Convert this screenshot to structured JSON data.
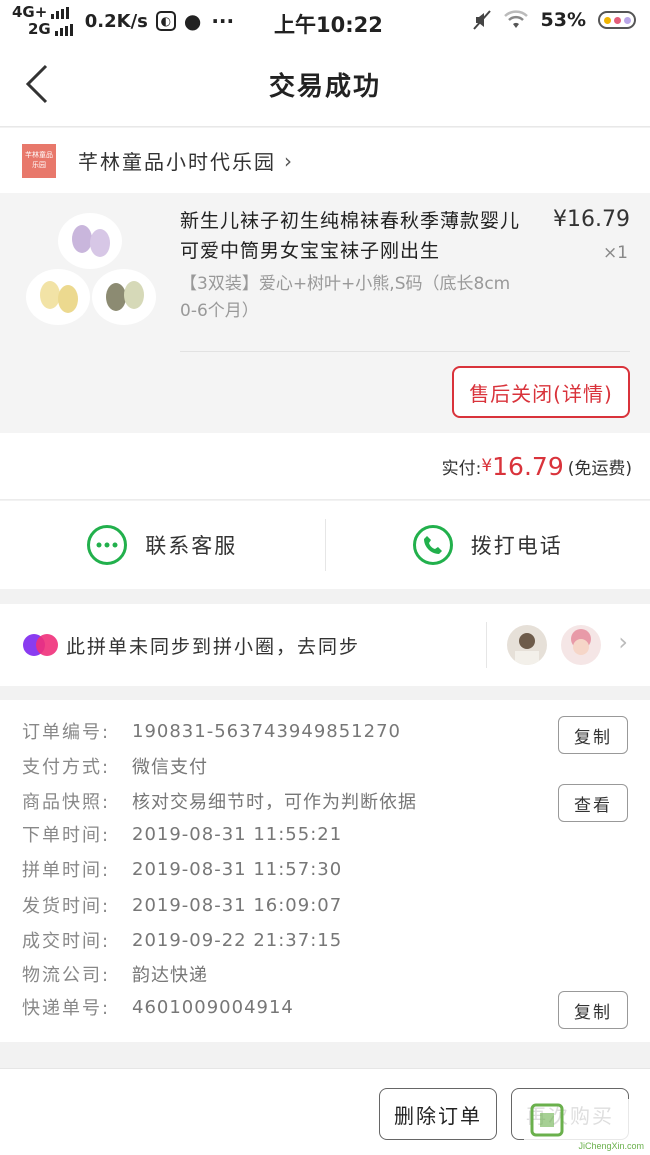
{
  "status_bar": {
    "network_top": "4G+",
    "network_bottom": "2G",
    "speed": "0.2K/s",
    "time": "上午10:22",
    "battery": "53%"
  },
  "header": {
    "title": "交易成功"
  },
  "shop": {
    "logo_text": "芊林童品乐园",
    "name": "芊林童品小时代乐园",
    "chevron": "›"
  },
  "item": {
    "title": "新生儿袜子初生纯棉袜春秋季薄款婴儿可爱中筒男女宝宝袜子刚出生",
    "price": "¥16.79",
    "qty": "×1",
    "spec": "【3双装】爱心+树叶+小熊,S码（底长8cm 0-6个月）",
    "after_sale_label": "售后关闭(详情)"
  },
  "payment": {
    "label": "实付:",
    "currency": "¥",
    "amount": "16.79",
    "shipping_note": "(免运费)"
  },
  "contact": {
    "service_label": "联系客服",
    "phone_label": "拨打电话"
  },
  "group": {
    "text": "此拼单未同步到拼小圈，去同步",
    "chevron": "›"
  },
  "order_info": {
    "rows": [
      {
        "label": "订单编号:",
        "value": "190831-563743949851270"
      },
      {
        "label": "支付方式:",
        "value": "微信支付"
      },
      {
        "label": "商品快照:",
        "value": "核对交易细节时，可作为判断依据"
      },
      {
        "label": "下单时间:",
        "value": "2019-08-31 11:55:21"
      },
      {
        "label": "拼单时间:",
        "value": "2019-08-31 11:57:30"
      },
      {
        "label": "发货时间:",
        "value": "2019-08-31 16:09:07"
      },
      {
        "label": "成交时间:",
        "value": "2019-09-22 21:37:15"
      },
      {
        "label": "物流公司:",
        "value": "韵达快递"
      },
      {
        "label": "快递单号:",
        "value": "4601009004914"
      }
    ],
    "copy_label": "复制",
    "view_label": "查看"
  },
  "bottom": {
    "delete_label": "删除订单",
    "rebuy_label": "再次购买",
    "watermark_text": "JiChengXin.com"
  },
  "colors": {
    "accent_red": "#d9333b",
    "green": "#22b04c"
  }
}
